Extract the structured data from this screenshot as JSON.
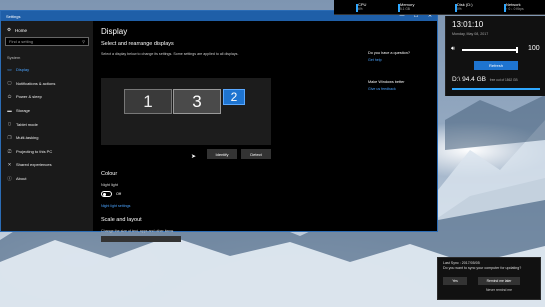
{
  "window": {
    "title": "Settings",
    "controls": [
      "—",
      "☐",
      "✕"
    ]
  },
  "sidebar": {
    "home": "Home",
    "search_placeholder": "Find a setting",
    "section": "System",
    "items": [
      {
        "label": "Display",
        "icon": "monitor-icon",
        "active": true
      },
      {
        "label": "Notifications & actions",
        "icon": "notifications-icon"
      },
      {
        "label": "Power & sleep",
        "icon": "power-icon"
      },
      {
        "label": "Storage",
        "icon": "storage-icon"
      },
      {
        "label": "Tablet mode",
        "icon": "tablet-icon"
      },
      {
        "label": "Multi-tasking",
        "icon": "multitasking-icon"
      },
      {
        "label": "Projecting to this PC",
        "icon": "projecting-icon"
      },
      {
        "label": "Shared experiences",
        "icon": "shared-experiences-icon"
      },
      {
        "label": "About",
        "icon": "info-icon"
      }
    ]
  },
  "main": {
    "title": "Display",
    "subheading": "Select and rearrange displays",
    "description": "Select a display below to change its settings. Some settings are applied to all displays.",
    "monitors": [
      "1",
      "3",
      "2"
    ],
    "identify": "Identify",
    "detect": "Detect",
    "colour_heading": "Colour",
    "night_light_label": "Night light",
    "night_light_state": "Off",
    "night_light_link": "Night light settings",
    "scale_heading": "Scale and layout",
    "scale_desc": "Change the size of text, apps and other items"
  },
  "aside": {
    "question": "Do you have a question?",
    "help_link": "Get help",
    "better": "Make Windows better",
    "feedback_link": "Give us feedback"
  },
  "sysmon": {
    "cpu": {
      "name": "CPU",
      "value": "6%"
    },
    "memory": {
      "name": "Memory",
      "value": "5.1 GB"
    },
    "disk": {
      "name": "Disk (D:)",
      "value": "0%"
    },
    "network": {
      "name": "Network",
      "value": "↑ 0 ↓ 0 Kbps"
    }
  },
  "widget": {
    "time": "13:01:10",
    "date": "Monday, May 08, 2017",
    "volume": "100",
    "volume_level": 1.0,
    "refresh": "Refresh",
    "drive": "D:\\",
    "drive_size": "94.4 GB",
    "drive_free": "free out of 1862 GB"
  },
  "notification": {
    "line1": "Last Sync : 2017/05/05",
    "line2": "Do you want to sync your computer for updating?",
    "yes": "Yes",
    "later": "Remind me later",
    "never": "Never remind me"
  }
}
